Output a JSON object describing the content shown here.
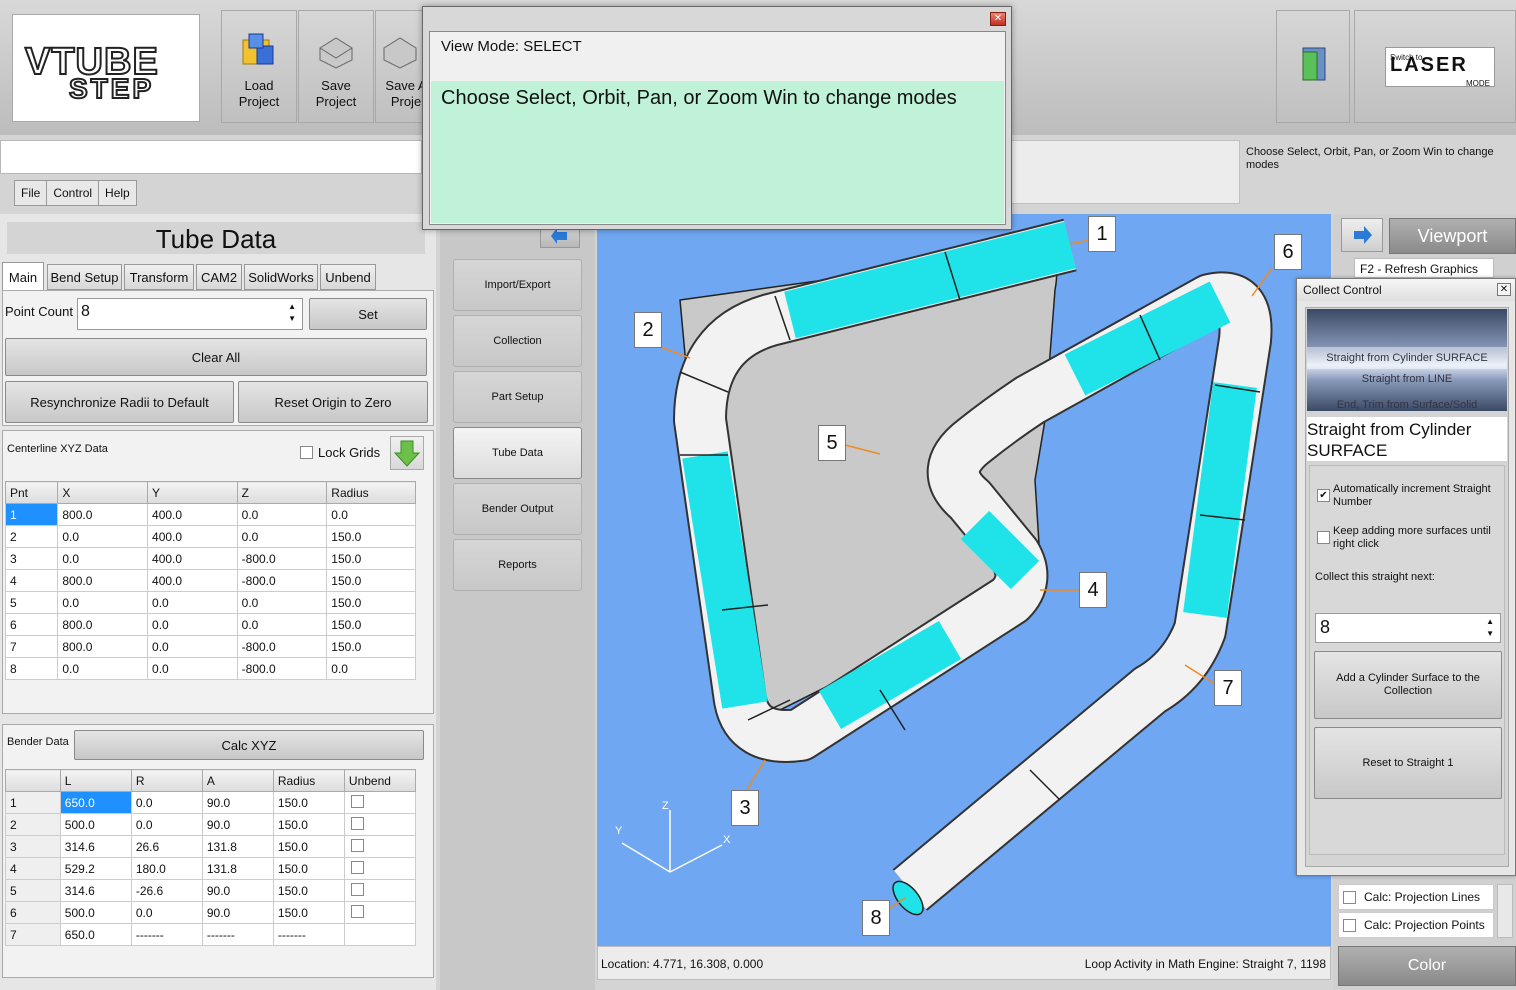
{
  "toolbar": {
    "logo_text_top": "VTUBE",
    "logo_text_bottom": "STEP",
    "load_label": "Load\nProject",
    "save_label": "Save\nProject",
    "save_as_label": "Save A\nProje",
    "laser_mode_top": "Switch to",
    "laser_mode_main": "LASER",
    "laser_mode_bottom": "MODE"
  },
  "menu": [
    "File",
    "Control",
    "Help"
  ],
  "status_hint": "Choose Select, Orbit, Pan, or Zoom Win to change modes",
  "popup": {
    "title": "View Mode: SELECT",
    "message": "Choose Select, Orbit, Pan, or Zoom Win to change modes"
  },
  "tube_data": {
    "title": "Tube Data",
    "tabs": [
      "Main",
      "Bend Setup",
      "Transform",
      "CAM2",
      "SolidWorks",
      "Unbend"
    ],
    "point_count_label": "Point Count",
    "point_count_value": "8",
    "set_label": "Set",
    "clear_all_label": "Clear All",
    "resync_label": "Resynchronize Radii to Default",
    "reset_origin_label": "Reset Origin to Zero",
    "centerline_label": "Centerline XYZ Data",
    "lock_grids_label": "Lock Grids",
    "xyz_headers": [
      "Pnt",
      "X",
      "Y",
      "Z",
      "Radius"
    ],
    "xyz_rows": [
      [
        "1",
        "800.0",
        "400.0",
        "0.0",
        "0.0"
      ],
      [
        "2",
        "0.0",
        "400.0",
        "0.0",
        "150.0"
      ],
      [
        "3",
        "0.0",
        "400.0",
        "-800.0",
        "150.0"
      ],
      [
        "4",
        "800.0",
        "400.0",
        "-800.0",
        "150.0"
      ],
      [
        "5",
        "0.0",
        "0.0",
        "0.0",
        "150.0"
      ],
      [
        "6",
        "800.0",
        "0.0",
        "0.0",
        "150.0"
      ],
      [
        "7",
        "800.0",
        "0.0",
        "-800.0",
        "150.0"
      ],
      [
        "8",
        "0.0",
        "0.0",
        "-800.0",
        "0.0"
      ]
    ],
    "bender_label": "Bender Data",
    "calc_xyz_label": "Calc XYZ",
    "bender_headers": [
      "",
      "L",
      "R",
      "A",
      "Radius",
      "Unbend"
    ],
    "bender_rows": [
      [
        "1",
        "650.0",
        "0.0",
        "90.0",
        "150.0",
        "box"
      ],
      [
        "2",
        "500.0",
        "0.0",
        "90.0",
        "150.0",
        "box"
      ],
      [
        "3",
        "314.6",
        "26.6",
        "131.8",
        "150.0",
        "box"
      ],
      [
        "4",
        "529.2",
        "180.0",
        "131.8",
        "150.0",
        "box"
      ],
      [
        "5",
        "314.6",
        "-26.6",
        "90.0",
        "150.0",
        "box"
      ],
      [
        "6",
        "500.0",
        "0.0",
        "90.0",
        "150.0",
        "box"
      ],
      [
        "7",
        "650.0",
        "-------",
        "-------",
        "-------",
        ""
      ]
    ]
  },
  "side_menu": [
    "Import/Export",
    "Collection",
    "Part Setup",
    "Tube Data",
    "Bender Output",
    "Reports"
  ],
  "viewport": {
    "callouts": [
      "1",
      "2",
      "3",
      "4",
      "5",
      "6",
      "7",
      "8"
    ],
    "axis_labels": {
      "x": "X",
      "y": "Y",
      "z": "Z"
    },
    "location_text": "Location: 4.771, 16.308, 0.000",
    "loop_text": "Loop Activity in Math Engine:  Straight 7, 1198"
  },
  "right_panel": {
    "viewport_label": "Viewport",
    "refresh_label": "F2 - Refresh Graphics",
    "calc_lines_label": "Calc: Projection Lines",
    "calc_points_label": "Calc: Projection Points",
    "color_label": "Color"
  },
  "collect_control": {
    "title": "Collect Control",
    "list": [
      "Straight from Cylinder SURFACE",
      "Straight from LINE",
      "End, Trim from Surface/Solid"
    ],
    "heading": "Straight from Cylinder SURFACE",
    "auto_increment_label": "Automatically increment Straight Number",
    "keep_adding_label": "Keep adding more surfaces until right click",
    "collect_next_label": "Collect this straight next:",
    "straight_value": "8",
    "add_label": "Add a Cylinder Surface to the Collection",
    "reset_label": "Reset to Straight 1"
  }
}
